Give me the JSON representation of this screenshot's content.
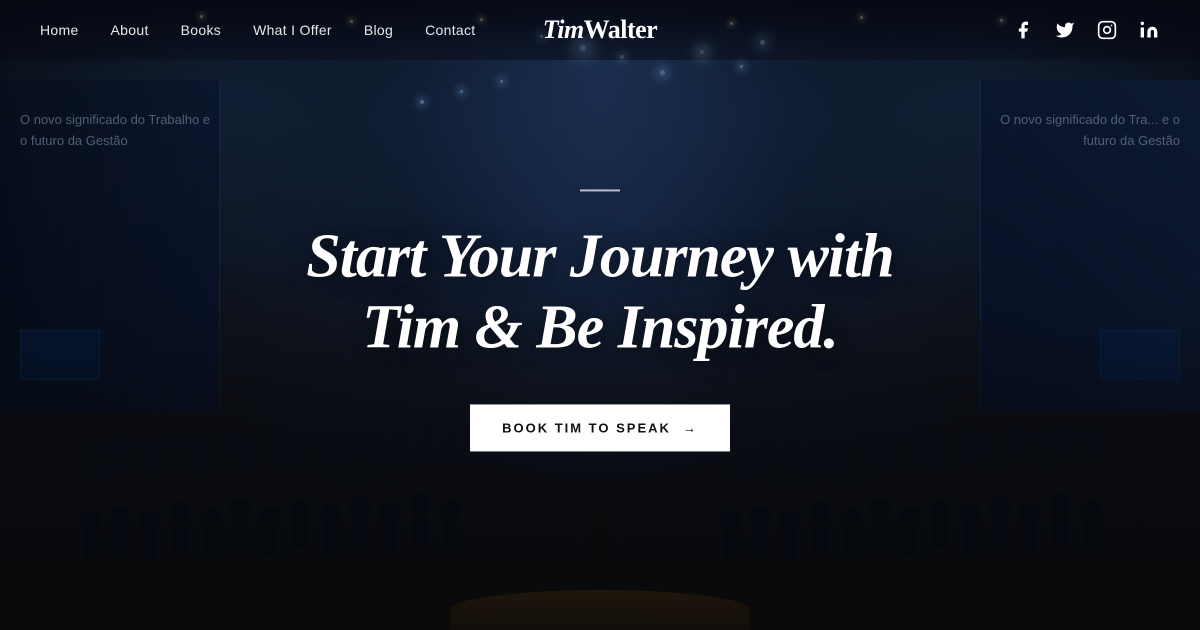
{
  "nav": {
    "items": [
      {
        "label": "Home",
        "id": "home"
      },
      {
        "label": "About",
        "id": "about"
      },
      {
        "label": "Books",
        "id": "books"
      },
      {
        "label": "What I Offer",
        "id": "what-i-offer"
      },
      {
        "label": "Blog",
        "id": "blog"
      },
      {
        "label": "Contact",
        "id": "contact"
      }
    ],
    "logo": "TimWalter",
    "social": [
      {
        "name": "facebook",
        "icon": "f"
      },
      {
        "name": "twitter",
        "icon": "t"
      },
      {
        "name": "instagram",
        "icon": "i"
      },
      {
        "name": "linkedin",
        "icon": "in"
      }
    ]
  },
  "hero": {
    "divider": "",
    "title_line1": "Start Your Journey with",
    "title_line2": "Tim & Be Inspired.",
    "cta_label": "BOOK TIM TO SPEAK",
    "cta_arrow": "→",
    "screen_left_text": "O novo significado do Trabalho\ne o futuro da Gestão",
    "screen_right_text": "O novo significado do Tra...\ne o futuro da Gestão"
  }
}
